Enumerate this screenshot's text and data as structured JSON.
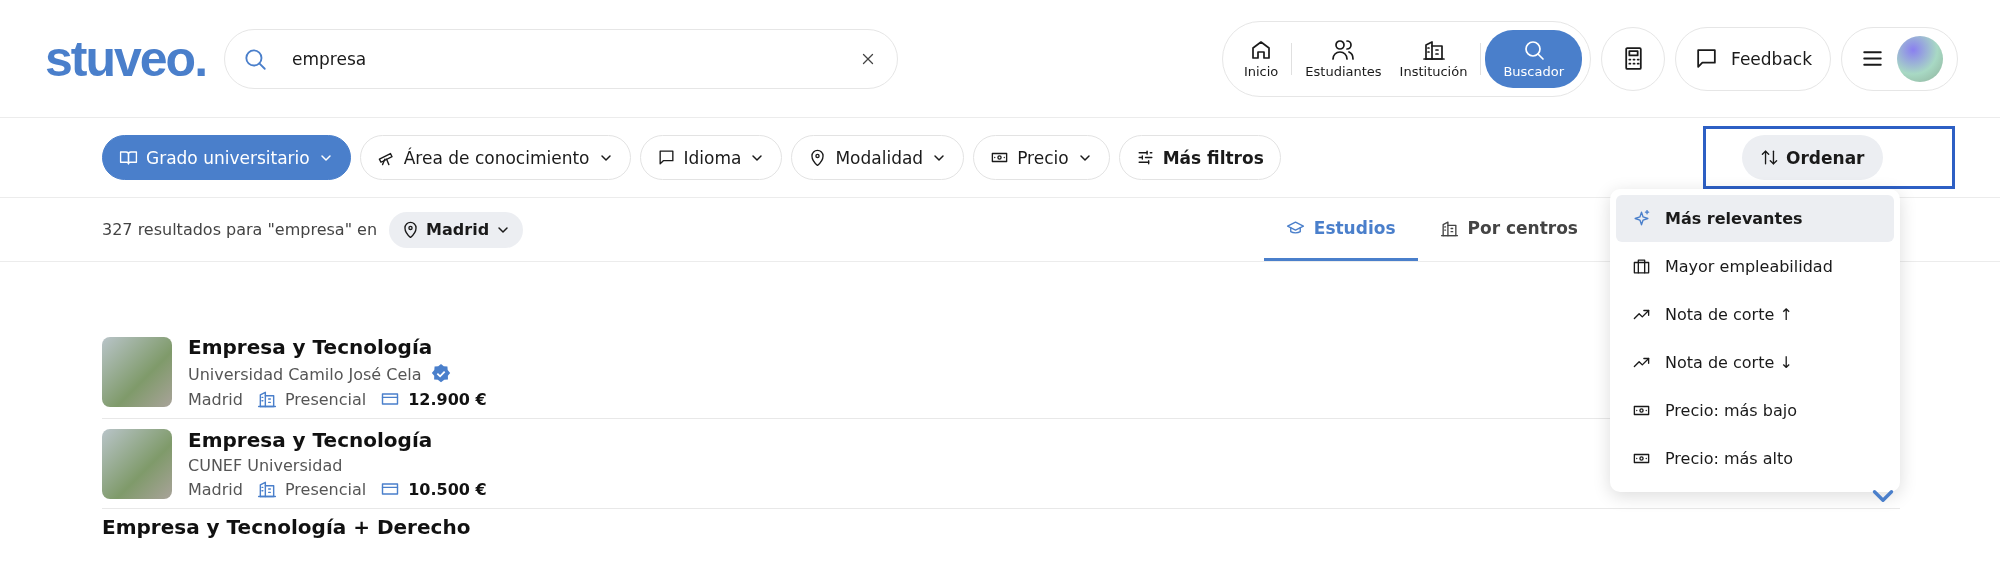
{
  "header": {
    "logo": "stuveo.",
    "search": {
      "value": "empresa"
    },
    "nav": [
      {
        "label": "Inicio",
        "selected": false
      },
      {
        "label": "Estudiantes",
        "selected": false
      },
      {
        "label": "Institución",
        "selected": false
      },
      {
        "label": "Buscador",
        "selected": true
      }
    ],
    "feedback": "Feedback"
  },
  "filters": [
    {
      "label": "Grado universitario",
      "selected": true,
      "has_menu": true
    },
    {
      "label": "Área de conocimiento",
      "selected": false,
      "has_menu": true
    },
    {
      "label": "Idioma",
      "selected": false,
      "has_menu": true
    },
    {
      "label": "Modalidad",
      "selected": false,
      "has_menu": true
    },
    {
      "label": "Precio",
      "selected": false,
      "has_menu": true
    },
    {
      "label": "Más filtros",
      "selected": false,
      "has_menu": false
    }
  ],
  "sort": {
    "label": "Ordenar",
    "highlighted": true,
    "open": true,
    "options": [
      {
        "label": "Más relevantes",
        "selected": true
      },
      {
        "label": "Mayor empleabilidad",
        "selected": false
      },
      {
        "label": "Nota de corte ↑",
        "selected": false
      },
      {
        "label": "Nota de corte ↓",
        "selected": false
      },
      {
        "label": "Precio: más bajo",
        "selected": false
      },
      {
        "label": "Precio: más alto",
        "selected": false
      }
    ]
  },
  "results": {
    "summary": "327 resultados para \"empresa\" en",
    "location": "Madrid"
  },
  "view_tabs": [
    {
      "label": "Estudios",
      "selected": true
    },
    {
      "label": "Por centros",
      "selected": false
    }
  ],
  "items": [
    {
      "title": "Empresa y Tecnología",
      "institution": "Universidad Camilo José Cela",
      "verified": true,
      "city": "Madrid",
      "modality": "Presencial",
      "price": "12.900 €"
    },
    {
      "title": "Empresa y Tecnología",
      "institution": "CUNEF Universidad",
      "verified": false,
      "city": "Madrid",
      "modality": "Presencial",
      "price": "10.500 €"
    },
    {
      "title": "Empresa y Tecnología + Derecho"
    }
  ]
}
